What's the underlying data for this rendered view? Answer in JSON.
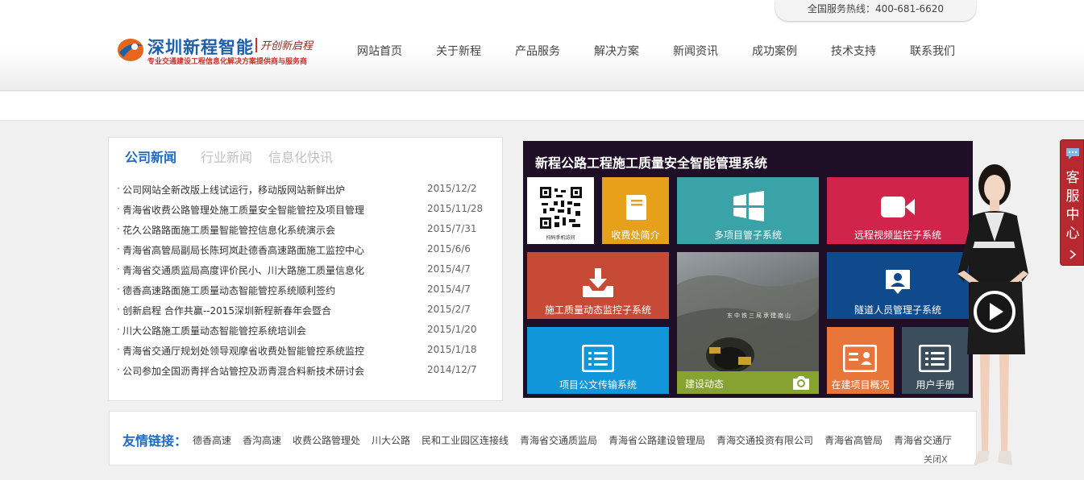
{
  "header": {
    "hotline": "全国服务热线：400-681-6620",
    "logo_name": "深圳新程智能",
    "logo_slogan": "开创新启程",
    "logo_sub": "专业交通建设工程信息化解决方案提供商与服务商"
  },
  "nav": [
    "网站首页",
    "关于新程",
    "产品服务",
    "解决方案",
    "新闻资讯",
    "成功案例",
    "技术支持",
    "联系我们"
  ],
  "news": {
    "tabs": [
      "公司新闻",
      "行业新闻",
      "信息化快讯"
    ],
    "items": [
      {
        "title": "公司网站全新改版上线试运行，移动版网站新鲜出炉",
        "date": "2015/12/2"
      },
      {
        "title": "青海省收费公路管理处施工质量安全智能管控及项目管理",
        "date": "2015/11/28"
      },
      {
        "title": "花久公路路面施工质量智能管控信息化系统演示会",
        "date": "2015/7/31"
      },
      {
        "title": "青海省高管局副局长陈珂岚赴德香高速路面施工监控中心",
        "date": "2015/6/6"
      },
      {
        "title": "青海省交通质监局高度评价民小、川大路施工质量信息化",
        "date": "2015/4/7"
      },
      {
        "title": "德香高速路面施工质量动态智能管控系统顺利签约",
        "date": "2015/4/7"
      },
      {
        "title": "创新启程 合作共赢--2015深圳新程新春年会暨合",
        "date": "2015/2/7"
      },
      {
        "title": "川大公路施工质量动态智能管控系统培训会",
        "date": "2015/1/20"
      },
      {
        "title": "青海省交通厅规划处领导观摩省收费处智能管控系统监控",
        "date": "2015/1/18"
      },
      {
        "title": "公司参加全国沥青拌合站管控及沥青混合料新技术研讨会",
        "date": "2014/12/7"
      }
    ]
  },
  "tiles": {
    "title": "新程公路工程施工质量安全智能管理系统",
    "qr_caption": "扫码手机访问",
    "toll": "收费处简介",
    "multi": "多项目管子系统",
    "video": "远程视频监控子系统",
    "quality": "施工质量动态监控子系统",
    "photo_text": "东中铁三局承建南山",
    "construction": "建设动态",
    "tunnel": "隧道人员管理子系统",
    "docs": "项目公文传输系统",
    "overview": "在建项目概况",
    "manual": "用户手册"
  },
  "links": {
    "title": "友情链接：",
    "items": [
      "德香高速",
      "香沟高速",
      "收费公路管理处",
      "川大公路",
      "民和工业园区连接线",
      "青海省交通质监局",
      "青海省公路建设管理局",
      "青海交通投资有限公司",
      "青海省高管局",
      "青海省交通厅"
    ],
    "close": "关闭X"
  },
  "cs": {
    "label": "客服中心"
  },
  "colors": {
    "brand_blue": "#1c6bc6",
    "tile_bg": "#1f0f26",
    "orange": "#e7a01a",
    "teal": "#3aa3a8",
    "crimson": "#d1244b",
    "red": "#c64a35",
    "navy": "#0f4a8c",
    "cyan": "#1096d9",
    "green": "#86a332",
    "orange2": "#e8763a",
    "slate": "#3b4e5c",
    "cs_red": "#b8282f"
  }
}
